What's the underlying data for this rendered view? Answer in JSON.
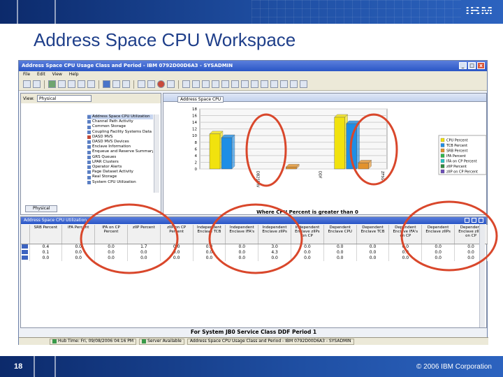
{
  "slide": {
    "title": "Address Space CPU Workspace",
    "logo": "IBM",
    "page_number": "18",
    "copyright": "© 2006 IBM Corporation"
  },
  "window": {
    "title": "Address Space CPU Usage Class and Period - IBM 0792D00D6A3 - SYSADMIN",
    "menu": [
      "File",
      "Edit",
      "View",
      "Help"
    ],
    "view_label": "View:",
    "view_selected": "Physical",
    "buttons": [
      "_",
      "□",
      "x"
    ]
  },
  "navigator": {
    "items": [
      {
        "label": "Address Space CPU Utilization",
        "highlight": true
      },
      {
        "label": "Channel Path Activity"
      },
      {
        "label": "Common Storage"
      },
      {
        "label": "Coupling Facility Systems Data"
      },
      {
        "label": "DASD MVS"
      },
      {
        "label": "DASD MVS Devices"
      },
      {
        "label": "Enclave Information"
      },
      {
        "label": "Enqueue and Reserve Summary"
      },
      {
        "label": "GRS Queues"
      },
      {
        "label": "LPAR Clusters"
      },
      {
        "label": "Operator Alerts"
      },
      {
        "label": "Page Dataset Activity"
      },
      {
        "label": "Real Storage"
      },
      {
        "label": "System CPU Utilization"
      }
    ],
    "tab_label": "Physical"
  },
  "chart_panel": {
    "tab_label": "Address Space CPU",
    "caption": "Where CPU Percent is greater than 0"
  },
  "chart_data": {
    "type": "bar",
    "categories": [
      "DB2SERV",
      "DDF",
      "ZFSG"
    ],
    "ylim": [
      0,
      18
    ],
    "yticks": [
      0,
      2,
      4,
      6,
      8,
      10,
      12,
      14,
      16,
      18
    ],
    "series": [
      {
        "name": "CPU Percent",
        "values": [
          10.5,
          0,
          15.5
        ],
        "color": "#f1e20e"
      },
      {
        "name": "TCB Percent",
        "values": [
          9.4,
          0,
          13.6
        ],
        "color": "#1e8ee6"
      },
      {
        "name": "SRB Percent",
        "values": [
          0,
          0.6,
          1.8
        ],
        "color": "#e2922c"
      },
      {
        "name": "IFA Percent",
        "values": [
          0,
          0,
          0
        ],
        "color": "#2fb64d"
      },
      {
        "name": "IFA on CP Percent",
        "values": [
          0,
          0,
          0
        ],
        "color": "#29c2c2"
      },
      {
        "name": "zIIP Percent",
        "values": [
          0,
          0,
          0
        ],
        "color": "#2f8a3f"
      },
      {
        "name": "zIIP on CP Percent",
        "values": [
          0,
          0,
          0
        ],
        "color": "#6d4fb8"
      }
    ],
    "grid": true,
    "legend_position": "right"
  },
  "table_panel": {
    "title": "Address Space CPU Utilization",
    "columns": [
      "",
      "SRB Percent",
      "IFA Percent",
      "IFA on CP Percent",
      "zIIP Percent",
      "zIIP on CP Percent",
      "Independent Enclave TCB",
      "Independent Enclave IFA's",
      "Independent Enclave zIIPs",
      "Independent Enclave zIIPs on CP",
      "Dependent Enclave CPU",
      "Dependent Enclave TCB",
      "Dependent Enclave IFA's on CP",
      "Dependent Enclave zIIPs",
      "Dependent Enclave zIIPs on CP"
    ],
    "rows": [
      [
        "0.4",
        "0.0",
        "0.0",
        "1.7",
        "0.0",
        "0.0",
        "0.0",
        "3.0",
        "0.0",
        "0.0",
        "0.0",
        "0.0",
        "0.0",
        "0.0"
      ],
      [
        "0.1",
        "0.0",
        "0.0",
        "0.0",
        "0.0",
        "0.0",
        "0.0",
        "4.3",
        "0.0",
        "0.0",
        "0.0",
        "0.0",
        "0.0",
        "0.0"
      ],
      [
        "0.0",
        "0.0",
        "0.0",
        "0.0",
        "0.0",
        "0.0",
        "0.0",
        "0.0",
        "0.0",
        "0.0",
        "0.0",
        "0.0",
        "0.0",
        "0.0"
      ]
    ],
    "caption": "For System JB0 Service Class DDF Period 1"
  },
  "statusbar": {
    "items": [
      "Hub Time: Fri, 09/08/2006 04:16 PM",
      "Server Available",
      "Address Space CPU Usage Class and Period - IBM 0792D00D6A3 - SYSADMIN"
    ]
  }
}
